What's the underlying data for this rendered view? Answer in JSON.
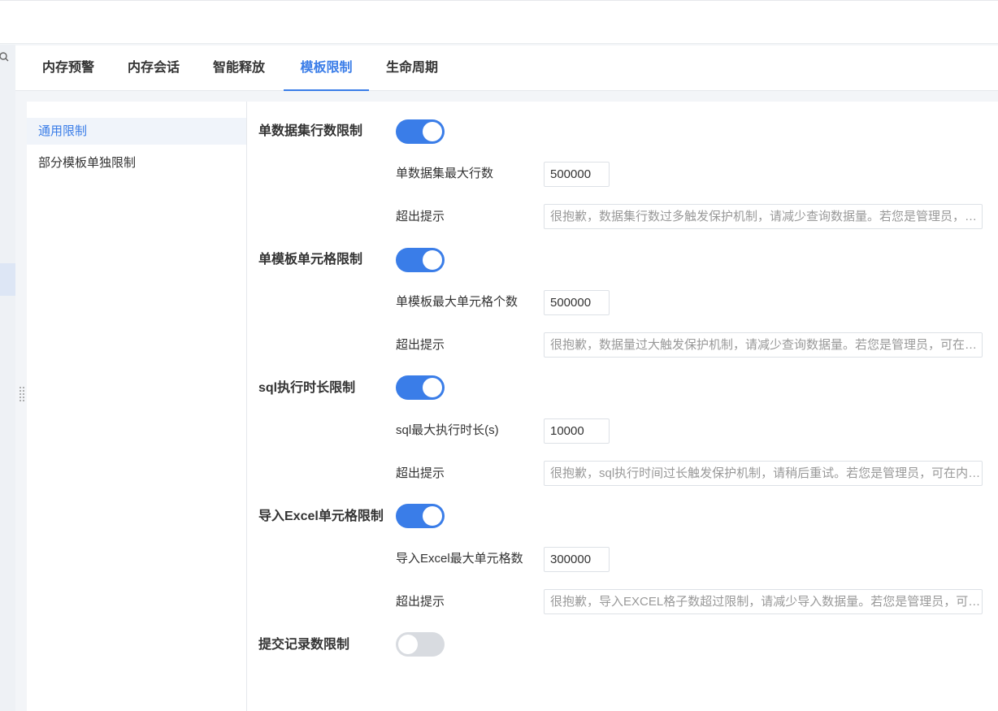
{
  "tabs": [
    {
      "label": "内存预警",
      "active": false
    },
    {
      "label": "内存会话",
      "active": false
    },
    {
      "label": "智能释放",
      "active": false
    },
    {
      "label": "模板限制",
      "active": true
    },
    {
      "label": "生命周期",
      "active": false
    }
  ],
  "sidenav": {
    "items": [
      {
        "label": "通用限制",
        "active": true
      },
      {
        "label": "部分模板单独限制",
        "active": false
      }
    ]
  },
  "settings": {
    "dataset_rows": {
      "title": "单数据集行数限制",
      "enabled": true,
      "max_label": "单数据集最大行数",
      "max_value": "500000",
      "hint_label": "超出提示",
      "hint_value": "很抱歉，数据集行数过多触发保护机制，请减少查询数据量。若您是管理员，可在内存管理中调整单数据集最大行数。"
    },
    "template_cells": {
      "title": "单模板单元格限制",
      "enabled": true,
      "max_label": "单模板最大单元格个数",
      "max_value": "500000",
      "hint_label": "超出提示",
      "hint_value": "很抱歉，数据量过大触发保护机制，请减少查询数据量。若您是管理员，可在内存管理中调整单模板最大单元格个数。"
    },
    "sql_duration": {
      "title": "sql执行时长限制",
      "enabled": true,
      "max_label": "sql最大执行时长(s)",
      "max_value": "10000",
      "hint_label": "超出提示",
      "hint_value": "很抱歉，sql执行时间过长触发保护机制，请稍后重试。若您是管理员，可在内存管理中调整sql最大执行时长。"
    },
    "excel_cells": {
      "title": "导入Excel单元格限制",
      "enabled": true,
      "max_label": "导入Excel最大单元格数",
      "max_value": "300000",
      "hint_label": "超出提示",
      "hint_value": "很抱歉，导入EXCEL格子数超过限制，请减少导入数据量。若您是管理员，可在内存管理中调整导入Excel最大单元格数。"
    },
    "submit_records": {
      "title": "提交记录数限制",
      "enabled": false
    }
  },
  "colors": {
    "accent": "#3a7de8",
    "switch_off": "#d8dbe0"
  }
}
